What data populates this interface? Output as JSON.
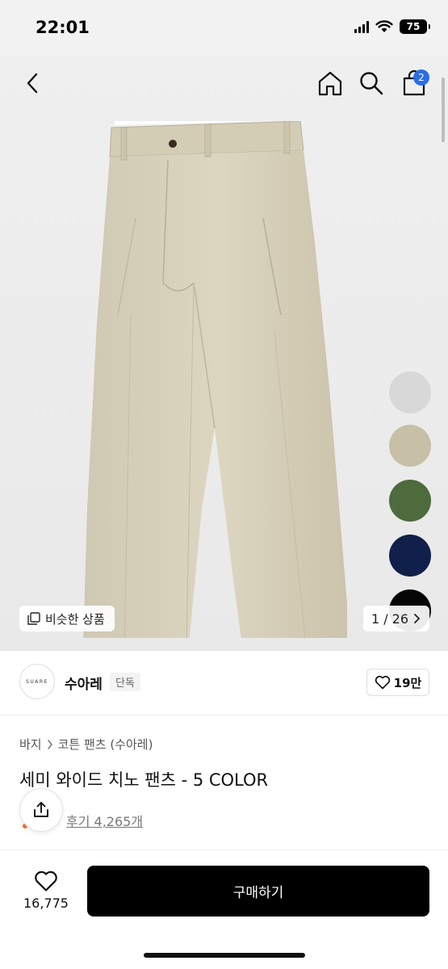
{
  "status_bar": {
    "time": "22:01",
    "battery": "75"
  },
  "nav": {
    "cart_count": "2"
  },
  "gallery": {
    "similar_label": "비슷한 상품",
    "page_counter": "1 / 26",
    "swatches": [
      "#d8d8d8",
      "#c7bfa6",
      "#4d6b3c",
      "#10204a",
      "#050505"
    ]
  },
  "brand": {
    "logo_text": "SUARE",
    "name": "수아레",
    "tag": "단독",
    "likes": "19만"
  },
  "breadcrumb": {
    "category": "바지",
    "subcategory": "코튼 팬츠 (수아레)"
  },
  "product": {
    "title": "세미 와이드 치노 팬츠 - 5 COLOR",
    "reviews": "후기 4,265개"
  },
  "bottom_bar": {
    "wish_count": "16,775",
    "buy_label": "구매하기"
  }
}
